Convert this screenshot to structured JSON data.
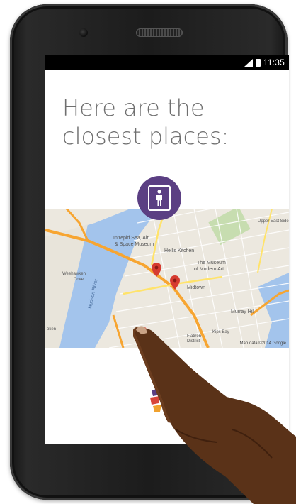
{
  "status_bar": {
    "time": "11:35"
  },
  "heading": {
    "line1": "Here are the",
    "line2": "closest places:"
  },
  "restroom_badge": {
    "icon": "restroom-icon",
    "color": "#5b3f83"
  },
  "map": {
    "labels": {
      "intrepid": "Intrepid Sea, Air",
      "space_museum": "& Space Museum",
      "hells_kitchen": "Hell's Kitchen",
      "museum_line1": "The Museum",
      "museum_line2": "of Modern Art",
      "midtown": "Midtown",
      "murray_hill": "Murray Hill",
      "hudson_river": "Hudson River",
      "flatiron": "Flatiron",
      "flatiron2": "District",
      "kips_bay": "Kips Bay",
      "upper_east": "Upper East Side",
      "weehawken": "Weehawken",
      "cove": "Cove",
      "oken": "oken",
      "attribution": "Map data ©2014 Google"
    },
    "markers": [
      {
        "label": "location-1",
        "color": "#d63b30"
      },
      {
        "label": "location-2",
        "color": "#d63b30"
      },
      {
        "label": "location-3",
        "color": "#d63b30"
      }
    ]
  },
  "app_logo": {
    "icon": "app-logo-icon"
  }
}
